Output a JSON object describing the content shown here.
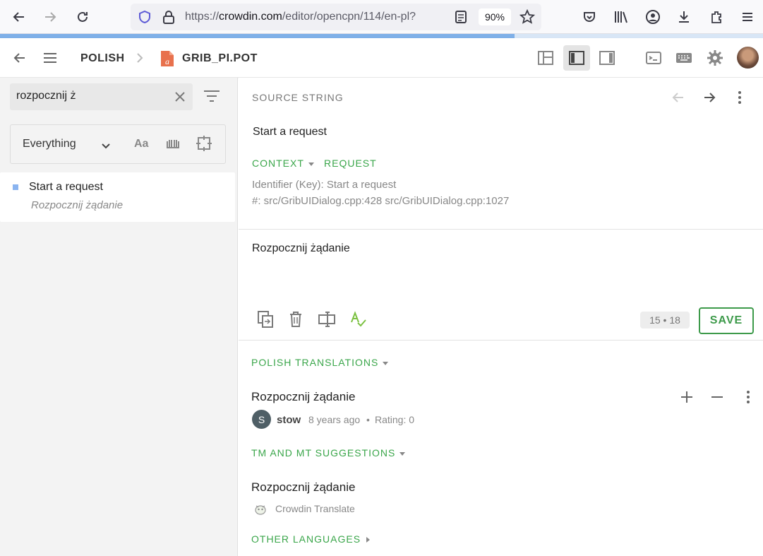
{
  "browser": {
    "url_prefix": "https://",
    "url_host": "crowdin.com",
    "url_path": "/editor/opencpn/114/en-pl?",
    "zoom": "90%",
    "load_progress": 0.674
  },
  "header": {
    "language": "POLISH",
    "file_name": "GRIB_PI.POT"
  },
  "search": {
    "value": "rozpocznij ż"
  },
  "filter": {
    "scope": "Everything",
    "case_label": "Aa"
  },
  "results": [
    {
      "source": "Start a request",
      "translation": "Rozpocznij żądanie"
    }
  ],
  "source": {
    "label": "SOURCE STRING",
    "text": "Start a request",
    "context_tab": "CONTEXT",
    "request_tab": "REQUEST",
    "identifier": "Identifier (Key): Start a request",
    "references": "#: src/GribUIDialog.cpp:428 src/GribUIDialog.cpp:1027"
  },
  "editor": {
    "translation_text": "Rozpocznij żądanie",
    "counter_source": "15",
    "counter_sep": "•",
    "counter_translation": "18",
    "save_label": "SAVE"
  },
  "translations": {
    "label": "POLISH TRANSLATIONS",
    "text": "Rozpocznij żądanie",
    "user_initial": "S",
    "user": "stow",
    "time": "8 years ago",
    "sep": "•",
    "rating": "Rating: 0"
  },
  "suggestions": {
    "label": "TM AND MT SUGGESTIONS",
    "text": "Rozpocznij żądanie",
    "provider": "Crowdin Translate"
  },
  "other_languages": {
    "label": "OTHER LANGUAGES"
  },
  "colors": {
    "accent_green": "#3aa64a",
    "loadbar": "#7fb0e8"
  }
}
